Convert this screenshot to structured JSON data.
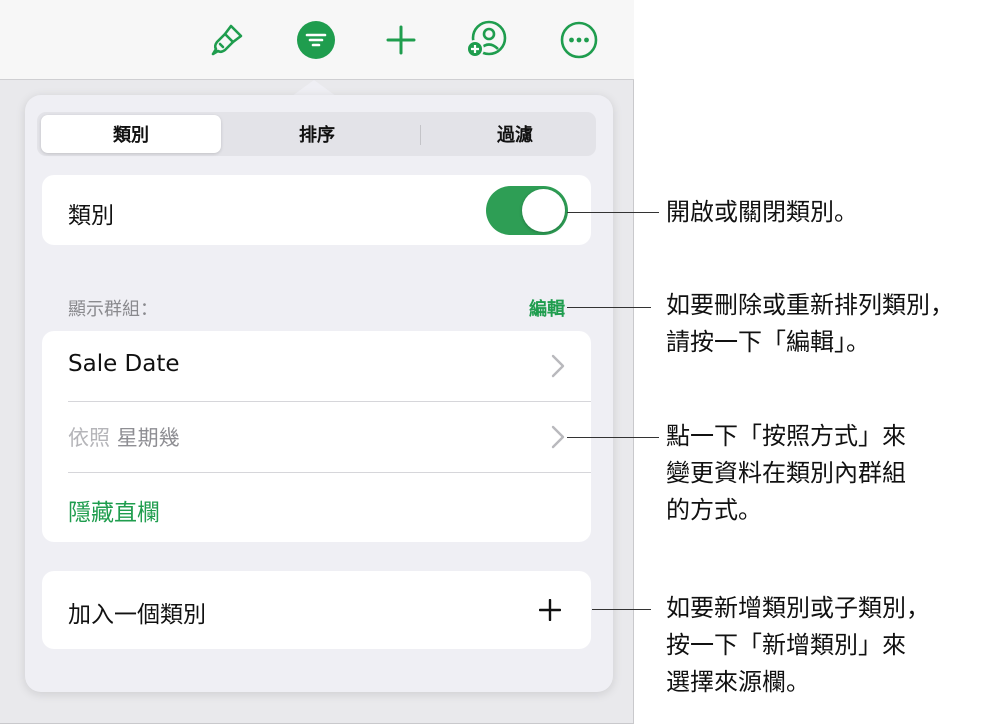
{
  "toolbar": {
    "icons": [
      "paintbrush-icon",
      "organize-icon",
      "plus-icon",
      "collaborate-icon",
      "more-icon"
    ]
  },
  "segments": [
    "類別",
    "排序",
    "過濾"
  ],
  "categories_toggle": {
    "label": "類別",
    "on": true
  },
  "section": {
    "header": "顯示群組：",
    "edit": "編輯"
  },
  "group_list": {
    "sale_date": "Sale Date",
    "group_by_prefix": "依照",
    "group_by_value": "星期幾",
    "hide_column": "隱藏直欄"
  },
  "add_category": {
    "label": "加入一個類別",
    "icon": "+"
  },
  "callouts": {
    "toggle": "開啟或關閉類別。",
    "edit": "如要刪除或重新排列類別，\n請按一下「編輯」。",
    "group_by": "點一下「按照方式」來\n變更資料在類別內群組\n的方式。",
    "add": "如要新增類別或子類別，\n按一下「新增類別」來\n選擇來源欄。"
  },
  "colors": {
    "accent": "#1f9d4e",
    "toggle_on": "#2e9e55"
  }
}
